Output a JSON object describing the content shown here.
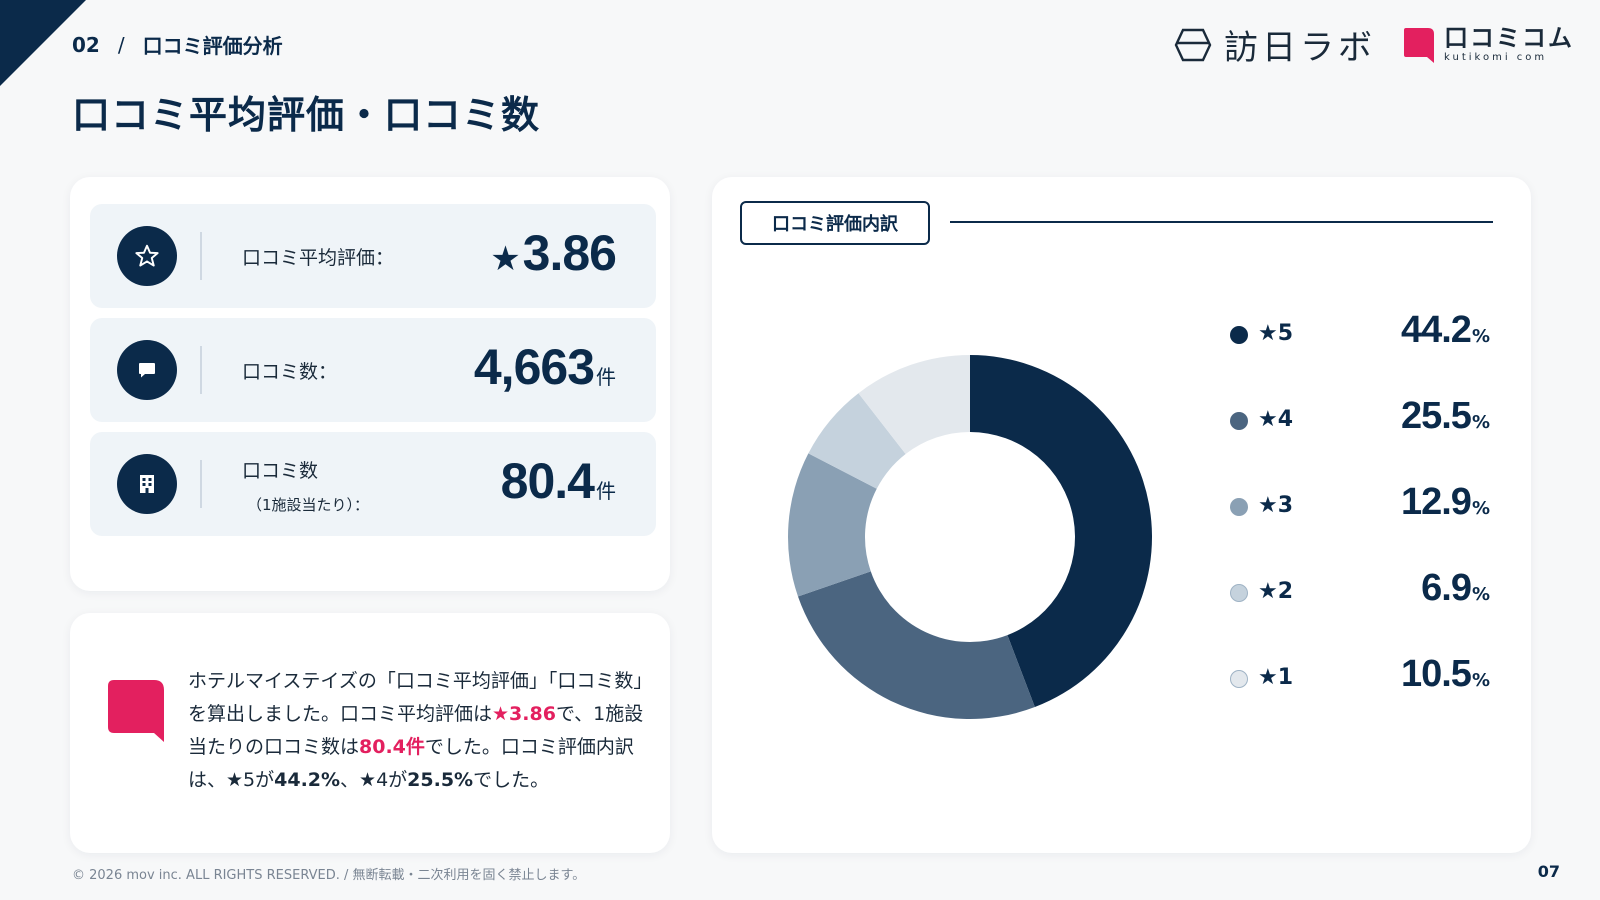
{
  "header": {
    "section_number": "02",
    "separator": "/",
    "section_name": "口コミ評価分析",
    "title": "口コミ平均評価・口コミ数"
  },
  "logos": {
    "houjin": "訪日ラボ",
    "kutikomi": "口コミコム",
    "kutikomi_sub": "kutikomi com"
  },
  "metrics": [
    {
      "label": "口コミ平均評価：",
      "prefix": "★",
      "value": "3.86",
      "unit": ""
    },
    {
      "label": "口コミ数：",
      "prefix": "",
      "value": "4,663",
      "unit": "件"
    },
    {
      "label": "口コミ数",
      "sublabel": "（1施設当たり）：",
      "prefix": "",
      "value": "80.4",
      "unit": "件"
    }
  ],
  "summary": {
    "t1": "ホテルマイステイズの「口コミ平均評価」「口コミ数」を算出しました。口コミ平均評価は",
    "v1": "★3.86",
    "t2": "で、1施設当たりの口コミ数は",
    "v2": "80.4件",
    "t3": "でした。口コミ評価内訳は、★5が",
    "v3": "44.2%",
    "t4": "、★4が",
    "v4": "25.5%",
    "t5": "でした。"
  },
  "chart_data": {
    "type": "pie",
    "title": "口コミ評価内訳",
    "categories": [
      "★5",
      "★4",
      "★3",
      "★2",
      "★1"
    ],
    "values": [
      44.2,
      25.5,
      12.9,
      6.9,
      10.5
    ],
    "value_labels": [
      "44.2",
      "25.5",
      "12.9",
      "6.9",
      "10.5"
    ],
    "unit": "%",
    "colors": [
      "#0b2a4a",
      "#4b6580",
      "#8aa0b4",
      "#c5d2dd",
      "#e3e8ed"
    ],
    "legend_placement": "right",
    "donut": true
  },
  "footer": {
    "copyright": "© 2026 mov inc. ALL RIGHTS RESERVED. / 無断転載・二次利用を固く禁止します。",
    "page": "07"
  }
}
